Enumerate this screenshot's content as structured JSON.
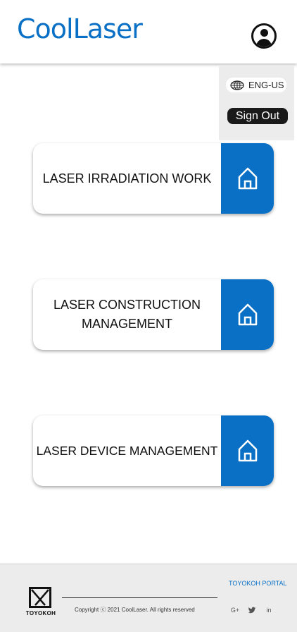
{
  "header": {
    "logo_text": "CoolLaser",
    "avatar_icon": "user-circle-icon"
  },
  "dropdown": {
    "language": "ENG-US",
    "language_icon": "globe-icon",
    "signout_label": "Sign Out"
  },
  "cards": [
    {
      "label": "LASER IRRADIATION WORK",
      "icon": "home-icon"
    },
    {
      "label": "LASER CONSTRUCTION MANAGEMENT",
      "icon": "home-icon"
    },
    {
      "label": "LASER DEVICE MANAGEMENT",
      "icon": "home-icon"
    }
  ],
  "footer": {
    "brand": "TOYOKOH",
    "portal_link": "TOYOKOH PORTAL",
    "copyright": "Copyright ⓒ 2021 CoolLaser. All rights reserved",
    "social": [
      {
        "icon": "google-plus-icon",
        "glyph": "G+"
      },
      {
        "icon": "twitter-icon",
        "glyph": ""
      },
      {
        "icon": "linkedin-icon",
        "glyph": "in"
      }
    ]
  },
  "colors": {
    "accent": "#0a70c5",
    "dark": "#1a1a1a",
    "panel": "#ececec"
  }
}
